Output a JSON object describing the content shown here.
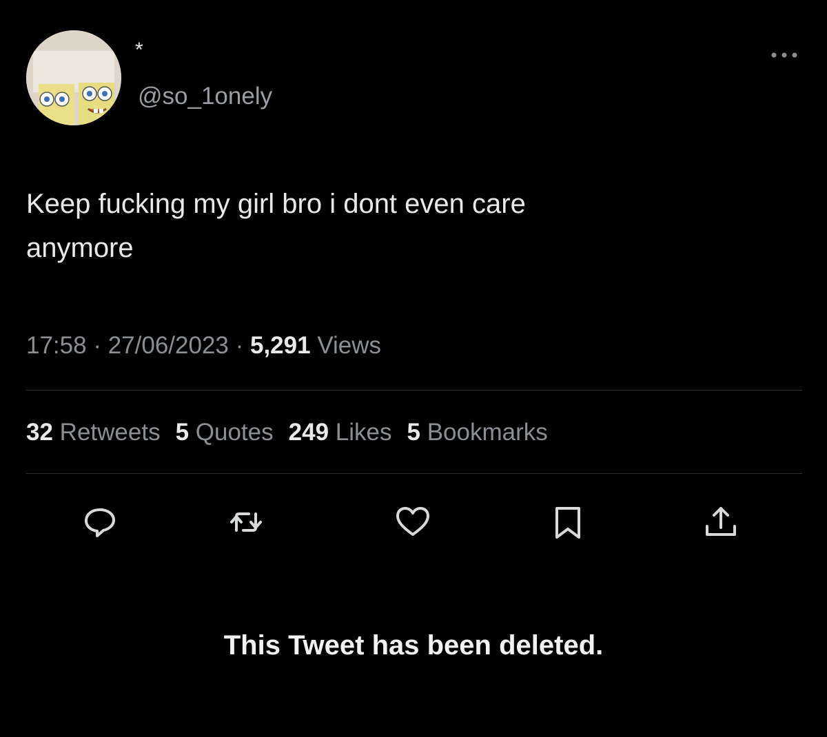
{
  "profile": {
    "display_name": "*",
    "handle": "@so_1onely",
    "avatar_icon": "spongebob-avatar-icon"
  },
  "tweet": {
    "text_line1": "Keep fucking my girl bro i dont even care",
    "text_line2": "anymore",
    "time": "17:58",
    "date": "27/06/2023",
    "views_count": "5,291",
    "views_label": "Views",
    "separator": " · "
  },
  "stats": {
    "retweets_count": "32",
    "retweets_label": "Retweets",
    "quotes_count": "5",
    "quotes_label": "Quotes",
    "likes_count": "249",
    "likes_label": "Likes",
    "bookmarks_count": "5",
    "bookmarks_label": "Bookmarks"
  },
  "actions": {
    "reply_icon": "reply-icon",
    "retweet_icon": "retweet-icon",
    "like_icon": "heart-icon",
    "bookmark_icon": "bookmark-icon",
    "share_icon": "share-icon",
    "more_icon": "more-dots-icon"
  },
  "notice": {
    "deleted_text": "This Tweet has been deleted."
  },
  "colors": {
    "background": "#000000",
    "primary_text": "#e7e9ea",
    "secondary_text": "#8b8f94",
    "divider": "#2a2d30"
  }
}
